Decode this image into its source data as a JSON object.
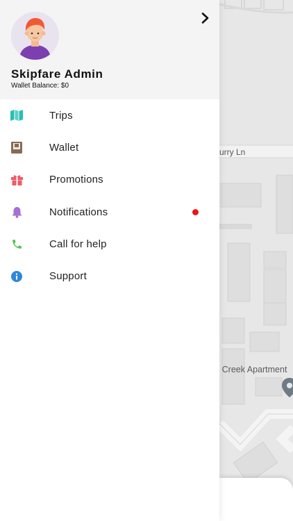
{
  "user": {
    "name": "Skipfare Admin",
    "wallet_balance": "Wallet Balance: $0",
    "avatar_icon": "user-avatar-icon"
  },
  "header": {
    "close_icon": "chevron-right-icon"
  },
  "menu": {
    "items": [
      {
        "label": "Trips",
        "icon": "map-icon",
        "color": "#27bfb6"
      },
      {
        "label": "Wallet",
        "icon": "wallet-icon",
        "color": "#8a6a55"
      },
      {
        "label": "Promotions",
        "icon": "gift-icon",
        "color": "#ef5a6a"
      },
      {
        "label": "Notifications",
        "icon": "bell-icon",
        "color": "#a56fd6",
        "badge_color": "#e8161b"
      },
      {
        "label": "Call for help",
        "icon": "phone-icon",
        "color": "#58c454"
      },
      {
        "label": "Support",
        "icon": "info-icon",
        "color": "#2e88d9"
      }
    ]
  },
  "map": {
    "street_label": "urry Ln",
    "poi_label": "r Creek Apartment",
    "pin_icon": "map-pin-icon"
  }
}
